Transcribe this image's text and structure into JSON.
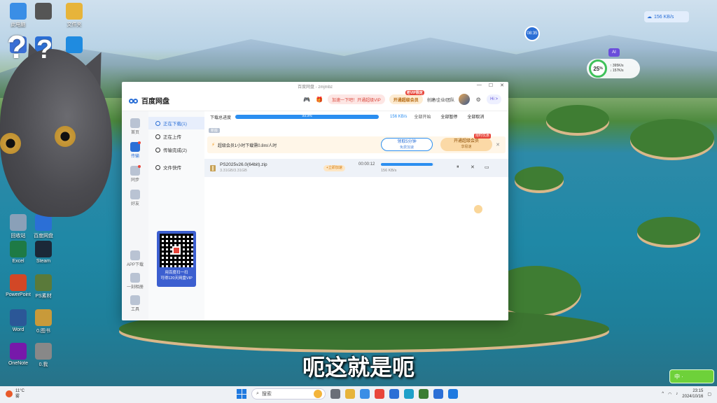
{
  "desktop": {
    "icons": [
      {
        "label": "此电脑",
        "color": "#3a8ee6"
      },
      {
        "label": "",
        "color": "#555555"
      },
      {
        "label": "文件夹",
        "color": "#e7b43a"
      },
      {
        "label": "",
        "color": "#3a6fd6"
      },
      {
        "label": "",
        "color": "#2b6fd6"
      },
      {
        "label": "",
        "color": "#1f8be0"
      },
      {
        "label": "回收站",
        "color": "#8aa0b8"
      },
      {
        "label": "百度网盘",
        "color": "#2b6fd6"
      },
      {
        "label": "Excel",
        "color": "#1e7a45"
      },
      {
        "label": "Steam",
        "color": "#1b2838"
      },
      {
        "label": "PowerPoint",
        "color": "#d24726"
      },
      {
        "label": "PS素材",
        "color": "#5a7a3a"
      },
      {
        "label": "Word",
        "color": "#2b5797"
      },
      {
        "label": "0.图书",
        "color": "#c89a3a"
      },
      {
        "label": "OneNote",
        "color": "#7719aa"
      },
      {
        "label": "0.我",
        "color": "#888888"
      }
    ],
    "net_speed": "156 KB/s",
    "clock_bubble": "08:35",
    "perf_percent": "25",
    "perf_up": "395K/s",
    "perf_down": "157K/s",
    "ai_label": "AI"
  },
  "window": {
    "title": "百度网盘 - zmjmbz",
    "logo_text": "百度网盘",
    "header": {
      "vip_promo": "加速一下吧！开通超级VIP",
      "team_promo": "开通超级会员",
      "team_tag": "老VIP限定",
      "team_link": "创建/企业/团队",
      "vip_badge": "Hi >"
    },
    "rail": [
      {
        "label": "首页",
        "active": false,
        "dot": false
      },
      {
        "label": "传输",
        "active": true,
        "dot": true
      },
      {
        "label": "同步",
        "active": false,
        "dot": true
      },
      {
        "label": "好友",
        "active": false,
        "dot": false
      }
    ],
    "rail_bottom": [
      {
        "label": "APP下载"
      },
      {
        "label": "一刻相册"
      },
      {
        "label": "工具"
      }
    ],
    "side": [
      {
        "label": "正在下载(1)",
        "active": true
      },
      {
        "label": "正在上传",
        "active": false
      },
      {
        "label": "传输完成(2)",
        "active": false
      },
      {
        "label": "文件快传",
        "active": false
      }
    ],
    "qr_caption_1": "用百度扫一扫",
    "qr_caption_2": "可得120天网盘VIP",
    "toolbar": {
      "label": "下载总进度",
      "progress": 0.999,
      "progress_text": "99.9%",
      "speed": "156 KB/s",
      "all_start": "全部开始",
      "all_pause": "全部暂停",
      "all_cancel": "全部取消",
      "tag": "新版"
    },
    "banner": {
      "text": "超级会员1小时下载需0.8m/人时",
      "btn1_main": "领取5分钟",
      "btn1_sub": "免费加速",
      "btn2_main": "开通超级会员",
      "btn2_sub": "享极速",
      "btn2_tag": "限时优惠"
    },
    "download": {
      "name": "PS2025v26.0(64bit).zip",
      "size": "3.31GB/3.31GB",
      "accel": "+立即加速",
      "remain": "00:00:12",
      "progress": 0.98,
      "speed": "156 KB/s"
    }
  },
  "subtitle": "呃这就是呃",
  "green_badge": "中 ·",
  "taskbar": {
    "weather_temp": "11°C",
    "weather_desc": "雾",
    "search_placeholder": "搜索",
    "time": "23:15",
    "date": "2024/10/16"
  }
}
